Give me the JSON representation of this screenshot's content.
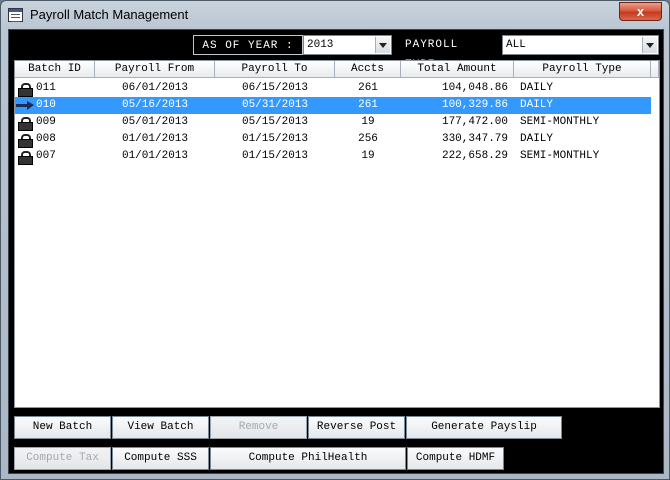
{
  "window": {
    "title": "Payroll Match Management",
    "close_glyph": "x"
  },
  "filters": {
    "as_of_year_label": "AS OF YEAR :",
    "year_value": "2013",
    "payroll_type_label": "PAYROLL TYPE",
    "payroll_type_value": "ALL"
  },
  "table": {
    "columns": [
      "Batch ID",
      "Payroll From",
      "Payroll To",
      "Accts",
      "Total Amount",
      "Payroll Type"
    ],
    "rows": [
      {
        "batch_id": "011",
        "from": "06/01/2013",
        "to": "06/15/2013",
        "accts": "261",
        "amount": "104,048.86",
        "type": "DAILY",
        "icon": "lock-icon",
        "selected": false
      },
      {
        "batch_id": "010",
        "from": "05/16/2013",
        "to": "05/31/2013",
        "accts": "261",
        "amount": "100,329.86",
        "type": "DAILY",
        "icon": "pointer-icon",
        "selected": true
      },
      {
        "batch_id": "009",
        "from": "05/01/2013",
        "to": "05/15/2013",
        "accts": "19",
        "amount": "177,472.00",
        "type": "SEMI-MONTHLY",
        "icon": "lock-icon",
        "selected": false
      },
      {
        "batch_id": "008",
        "from": "01/01/2013",
        "to": "01/15/2013",
        "accts": "256",
        "amount": "330,347.79",
        "type": "DAILY",
        "icon": "lock-icon",
        "selected": false
      },
      {
        "batch_id": "007",
        "from": "01/01/2013",
        "to": "01/15/2013",
        "accts": "19",
        "amount": "222,658.29",
        "type": "SEMI-MONTHLY",
        "icon": "lock-icon",
        "selected": false
      }
    ]
  },
  "buttons": {
    "new_batch": "New Batch",
    "view_batch": "View Batch",
    "remove": "Remove",
    "reverse_post": "Reverse Post",
    "generate_payslip": "Generate Payslip",
    "compute_tax": "Compute Tax",
    "compute_sss": "Compute SSS",
    "compute_philhealth": "Compute PhilHealth",
    "compute_hdmf": "Compute HDMF"
  },
  "colors": {
    "selection": "#3399ff",
    "client_background": "#000000",
    "close_button": "#c43b1f"
  }
}
